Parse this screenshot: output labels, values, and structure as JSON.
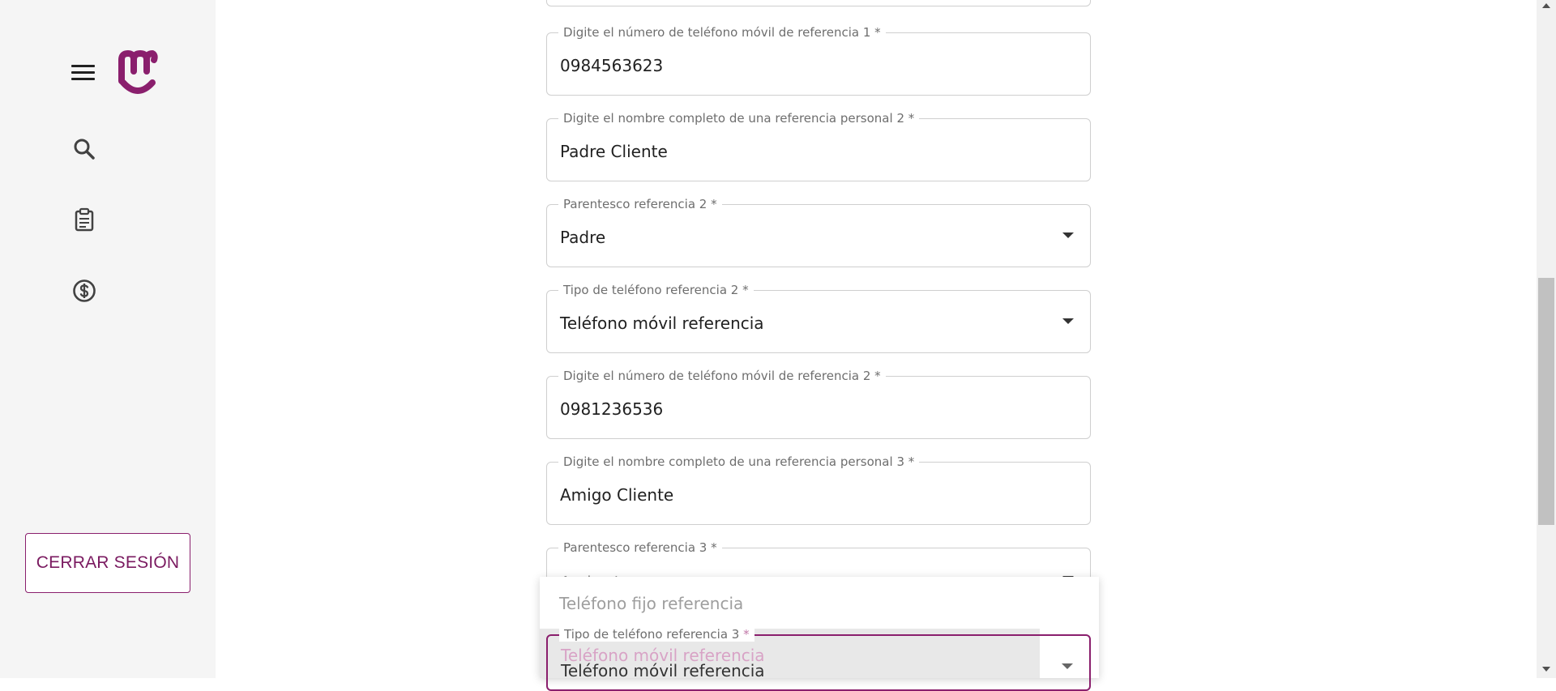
{
  "brand": {
    "accent_color": "#8a1f6d",
    "logo_icon": "m-smile-logo-icon"
  },
  "sidebar": {
    "nav_icons": [
      "menu-icon",
      "search-icon",
      "clipboard-icon",
      "dollar-circle-icon"
    ],
    "logout_label": "CERRAR SESIÓN"
  },
  "form": {
    "fields": [
      {
        "label": "Digite el número de teléfono móvil de referencia 1 *",
        "value": "0984563623"
      },
      {
        "label": "Digite el nombre completo de una referencia personal 2 *",
        "value": "Padre Cliente"
      },
      {
        "label": "Parentesco referencia 2 *",
        "value": "Padre"
      },
      {
        "label": "Tipo de teléfono referencia 2 *",
        "value": "Teléfono móvil referencia"
      },
      {
        "label": "Digite el número de teléfono móvil de referencia 2 *",
        "value": "0981236536"
      },
      {
        "label": "Digite el nombre completo de una referencia personal 3 *",
        "value": "Amigo Cliente"
      },
      {
        "label": "Parentesco referencia 3 *",
        "value": "Amigo/a"
      },
      {
        "label": "Tipo de teléfono referencia 3",
        "required_mark": "*",
        "value": "Teléfono móvil referencia"
      }
    ]
  },
  "dropdown": {
    "options": [
      "Teléfono fijo referencia",
      "Teléfono móvil referencia"
    ],
    "selected": "Teléfono móvil referencia"
  }
}
